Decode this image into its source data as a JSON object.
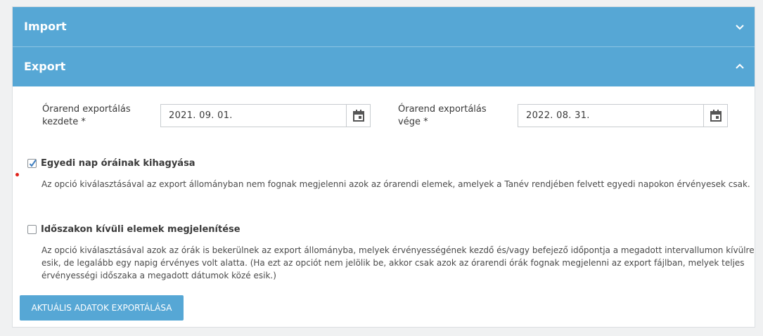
{
  "import_section": {
    "title": "Import",
    "icon": "chevron-down-icon"
  },
  "export_section": {
    "title": "Export",
    "icon": "chevron-up-icon",
    "start_date": {
      "label": "Órarend exportálás kezdete *",
      "value": "2021. 09. 01.",
      "icon": "calendar-icon"
    },
    "end_date": {
      "label": "Órarend exportálás vége *",
      "value": "2022. 08. 31.",
      "icon": "calendar-icon"
    },
    "option_skip_custom_days": {
      "label": "Egyedi nap óráinak kihagyása",
      "checked": true,
      "description": "Az opció kiválasztásával az export állományban nem fognak megjelenni azok az órarendi elemek, amelyek a Tanév rendjében felvett egyedi napokon érvényesek csak."
    },
    "option_out_of_range": {
      "label": "Időszakon kívüli elemek megjelenítése",
      "checked": false,
      "description_lines": [
        "Az opció kiválasztásával azok az órák is bekerülnek az export állományba, melyek érvényességének kezdő és/vagy befejező időpontja a megadott intervallumon kívülre",
        "esik, de legalább egy napig érvényes volt alatta. (Ha ezt az opciót nem jelölik be, akkor csak azok az órarendi órák fognak megjelenni az export fájlban, melyek teljes",
        "érvényességi időszaka a megadott dátumok közé esik.)"
      ]
    },
    "export_button": "AKTUÁLIS ADATOK EXPORTÁLÁSA"
  },
  "colors": {
    "header": "#56a7d5",
    "button": "#56a7d5",
    "marker": "#e0221b"
  }
}
